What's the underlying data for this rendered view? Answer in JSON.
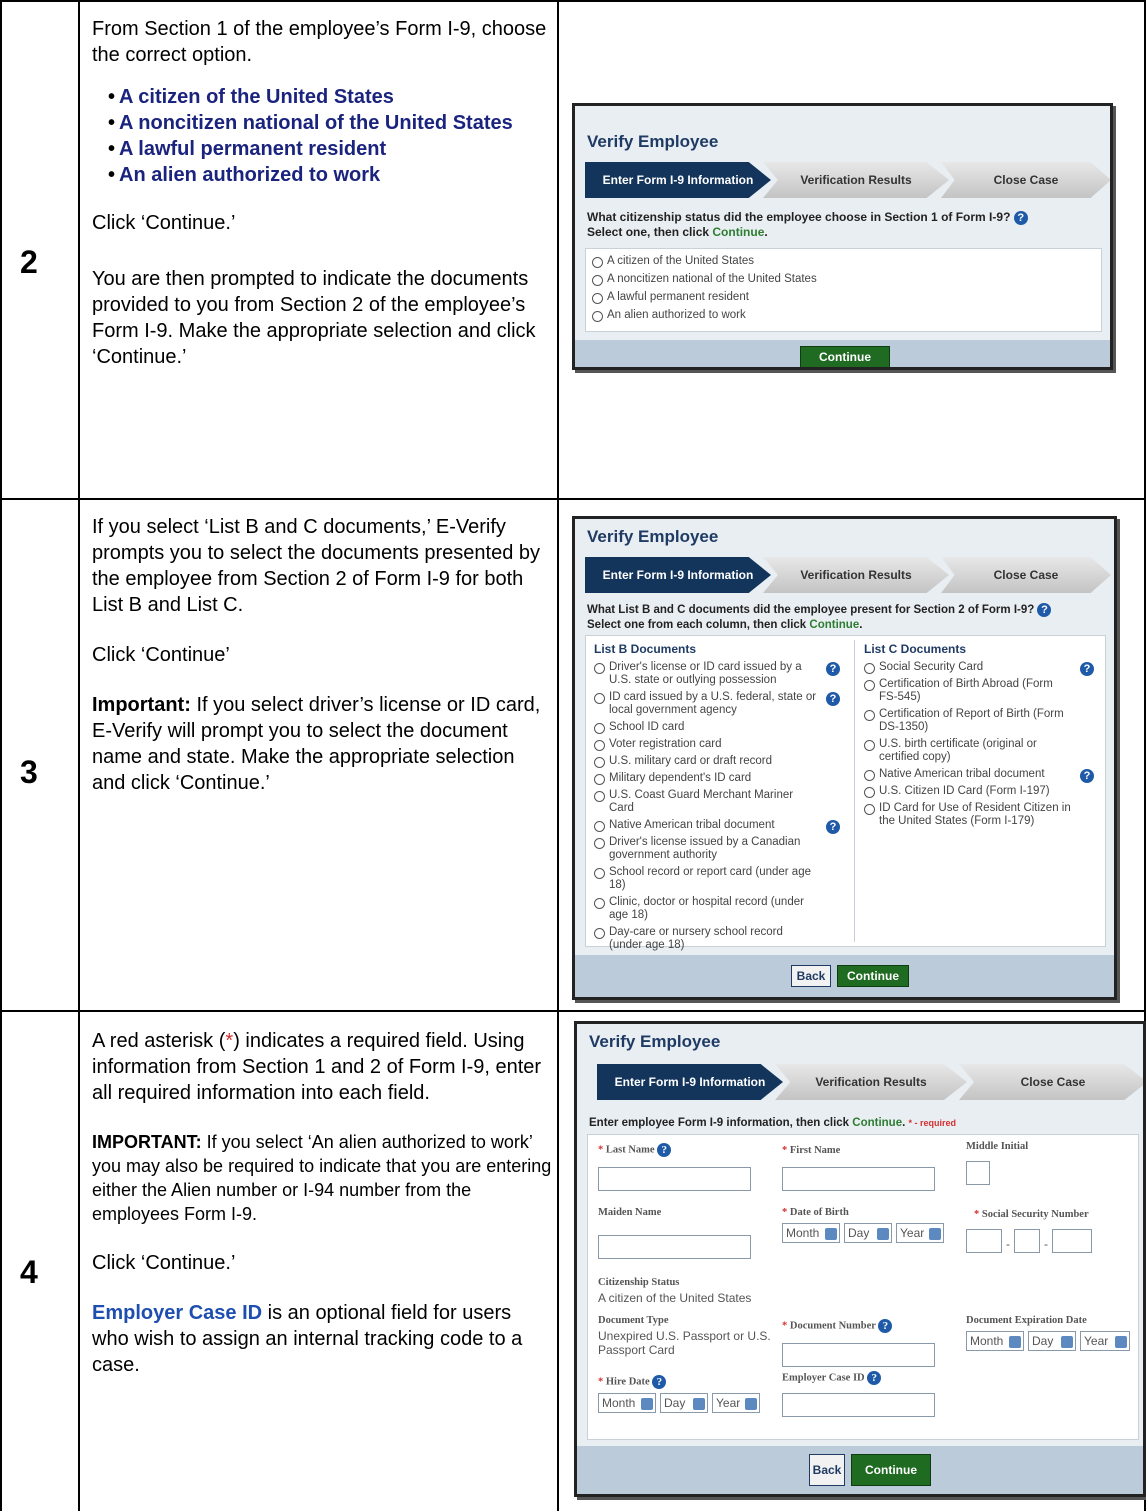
{
  "rows": [
    {
      "number": "2",
      "intro": "From Section 1 of the employee’s Form I-9, choose the correct option.",
      "bullets": [
        "A citizen of the United States",
        "A noncitizen national of the United States",
        "A lawful permanent resident",
        "An alien authorized to work"
      ],
      "click": "Click ‘Continue.’",
      "after": "You are then prompted to indicate the documents provided to you from Section 2 of the employee’s Form I-9. Make the appropriate selection and click ‘Continue.’"
    },
    {
      "number": "3",
      "p1": "If you select ‘List B and C documents,’ E-Verify prompts you to select the documents presented by the employee from Section 2 of Form I-9 for both List B and List C.",
      "p2": "Click ‘Continue’",
      "important_label": "Important:",
      "important_text": " If you select driver’s license or ID card, E-Verify will prompt you to select the document name and state. Make the appropriate selection and click ‘Continue.’"
    },
    {
      "number": "4",
      "p1_a": "A red asterisk (",
      "p1_ast": "*",
      "p1_b": ") indicates a required field. Using information from Section 1 and 2 of Form I-9, enter all required information into each field.",
      "important_label": "IMPORTANT:",
      "important_text": " If you select ‘An alien authorized to work’ you may also be required to indicate that you are entering either the Alien number or I-94 number from the employees Form I-9.",
      "click": "Click ‘Continue.’",
      "case_label": "Employer Case ID",
      "case_text": " is an optional field for users who wish to assign an internal tracking code to a case."
    }
  ],
  "ui": {
    "title": "Verify Employee",
    "steps": [
      "Enter Form I-9 Information",
      "Verification Results",
      "Close Case"
    ],
    "help_glyph": "?",
    "continue": "Continue",
    "back": "Back"
  },
  "shot1": {
    "q1": "What citizenship status did the employee choose in Section 1 of Form I-9?",
    "q2a": "Select one, then click ",
    "q2b": "Continue",
    "q2c": ".",
    "options": [
      "A citizen of the United States",
      "A noncitizen national of the United States",
      "A lawful permanent resident",
      "An alien authorized to work"
    ]
  },
  "shot2": {
    "q1": "What List B and C documents did the employee present for Section 2 of Form I-9?",
    "q2a": "Select one from each column, then click ",
    "q2b": "Continue",
    "q2c": ".",
    "list_b_header": "List B Documents",
    "list_c_header": "List C Documents",
    "list_b": [
      "Driver's license or ID card issued by a U.S. state or outlying possession",
      "ID card issued by a U.S. federal, state or local government agency",
      "School ID card",
      "Voter registration card",
      "U.S. military card or draft record",
      "Military dependent's ID card",
      "U.S. Coast Guard Merchant Mariner Card",
      "Native American tribal document",
      "Driver's license issued by a Canadian government authority",
      "School record or report card (under age 18)",
      "Clinic, doctor or hospital record (under age 18)",
      "Day-care or nursery school record (under age 18)"
    ],
    "list_c": [
      "Social Security Card",
      "Certification of Birth Abroad (Form FS-545)",
      "Certification of Report of Birth (Form DS-1350)",
      "U.S. birth certificate (original or certified copy)",
      "Native American tribal document",
      "U.S. Citizen ID Card (Form I-197)",
      "ID Card for Use of Resident Citizen in the United States (Form I-179)"
    ]
  },
  "shot3": {
    "instr_a": "Enter employee Form I-9 information, then click ",
    "instr_b": "Continue",
    "instr_c": ".",
    "instr_req": "* - required",
    "required_mark": "*",
    "last_name": "Last Name",
    "first_name": "First Name",
    "middle_initial": "Middle Initial",
    "maiden_name": "Maiden Name",
    "dob": "Date of Birth",
    "ssn": "Social Security Number",
    "citizenship_label": "Citizenship Status",
    "citizenship_value": "A citizen of the United States",
    "doc_type_label": "Document Type",
    "doc_type_value": "Unexpired U.S. Passport or U.S. Passport Card",
    "doc_number": "Document Number",
    "doc_exp": "Document Expiration Date",
    "hire_date": "Hire Date",
    "case_id": "Employer Case ID",
    "month": "Month",
    "day": "Day",
    "year": "Year",
    "ssn_dash": "-"
  }
}
